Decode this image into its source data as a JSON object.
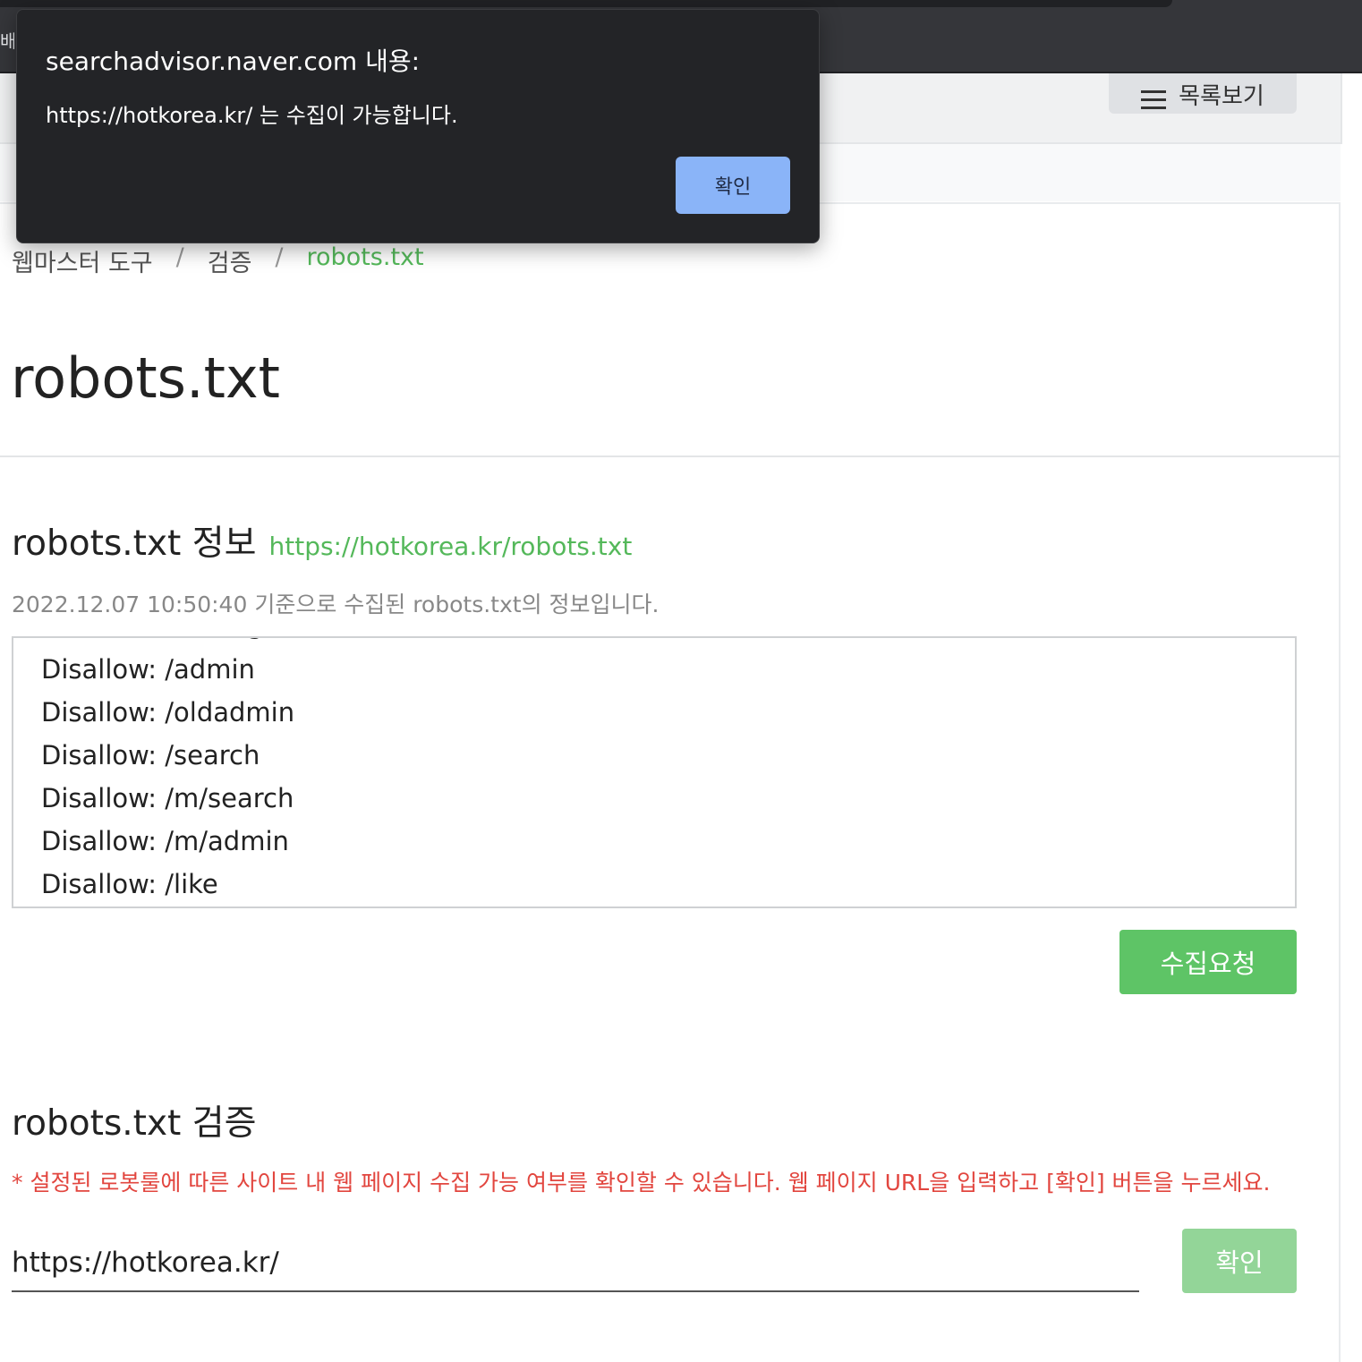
{
  "browser": {
    "bookmark_fragment": "배님"
  },
  "header": {
    "list_button_label": "목록보기"
  },
  "breadcrumb": {
    "items": [
      "웹마스터 도구",
      "검증",
      "robots.txt"
    ]
  },
  "page": {
    "title": "robots.txt"
  },
  "info": {
    "title": "robots.txt 정보",
    "link": "https://hotkorea.kr/robots.txt",
    "date_text": "2022.12.07 10:50:40 기준으로 수집된 robots.txt의 정보입니다.",
    "robots_lines": [
      "Disallow: /admin",
      "Disallow: /oldadmin",
      "Disallow: /search",
      "Disallow: /m/search",
      "Disallow: /m/admin",
      "Disallow: /like"
    ],
    "collect_button": "수집요청"
  },
  "verify": {
    "title": "robots.txt 검증",
    "note": "* 설정된 로봇룰에 따른 사이트 내 웹 페이지 수집 가능 여부를 확인할 수 있습니다. 웹 페이지 URL을 입력하고 [확인] 버튼을 누르세요.",
    "url_value": "https://hotkorea.kr/",
    "confirm_button": "확인"
  },
  "dialog": {
    "title": "searchadvisor.naver.com 내용:",
    "message": "https://hotkorea.kr/ 는 수집이 가능합니다.",
    "ok_button": "확인"
  },
  "colors": {
    "accent_green": "#5ec466",
    "link_green": "#54b85a",
    "note_red": "#e2463f",
    "dialog_bg": "#232427",
    "dialog_button": "#8ab4f8"
  }
}
